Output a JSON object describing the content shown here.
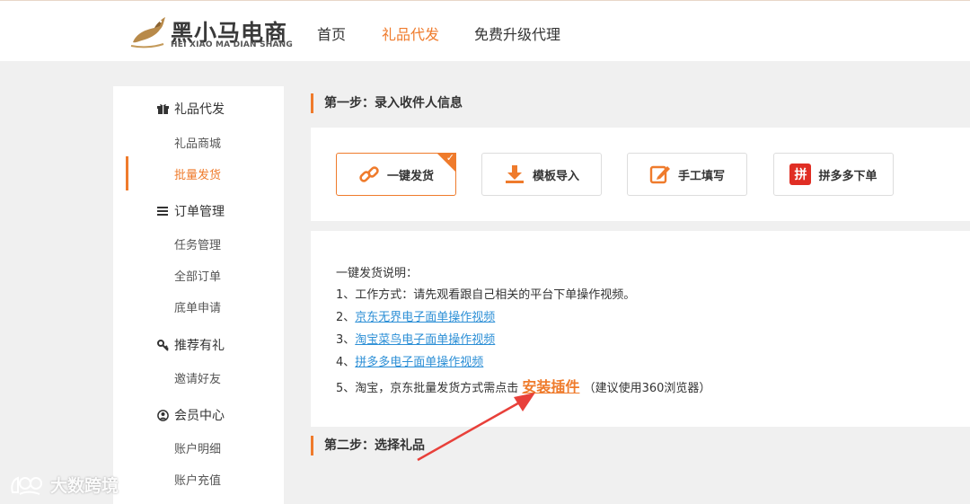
{
  "header": {
    "logo_cn": "黑小马电商",
    "logo_en": "HEI XIAO MA DIAN SHANG",
    "nav": [
      "首页",
      "礼品代发",
      "免费升级代理"
    ],
    "active_nav": "礼品代发"
  },
  "sidebar": {
    "groups": [
      {
        "title": "礼品代发",
        "icon": "gift-icon",
        "items": [
          "礼品商城",
          "批量发货"
        ]
      },
      {
        "title": "订单管理",
        "icon": "list-icon",
        "items": [
          "任务管理",
          "全部订单",
          "底单申请"
        ]
      },
      {
        "title": "推荐有礼",
        "icon": "key-icon",
        "items": [
          "邀请好友"
        ]
      },
      {
        "title": "会员中心",
        "icon": "user-icon",
        "items": [
          "账户明细",
          "账户充值"
        ]
      }
    ],
    "active_item": "批量发货"
  },
  "step1": {
    "title": "第一步：录入收件人信息",
    "buttons": [
      {
        "label": "一键发货",
        "icon": "link-icon",
        "selected": true
      },
      {
        "label": "模板导入",
        "icon": "download-icon",
        "selected": false
      },
      {
        "label": "手工填写",
        "icon": "edit-icon",
        "selected": false
      },
      {
        "label": "拼多多下单",
        "icon": "pinduoduo-icon",
        "selected": false
      }
    ],
    "pdd_icon_char": "拼"
  },
  "instructions": {
    "heading": "一键发货说明：",
    "line1": "1、工作方式：请先观看跟自己相关的平台下单操作视频。",
    "line2_prefix": "2、",
    "line2_link": "京东无界电子面单操作视频",
    "line3_prefix": "3、",
    "line3_link": "淘宝菜鸟电子面单操作视频",
    "line4_prefix": "4、",
    "line4_link": "拼多多电子面单操作视频",
    "line5_prefix": "5、淘宝，京东批量发货方式需点击",
    "line5_link": "安装插件",
    "line5_suffix": "（建议使用360浏览器）"
  },
  "step2": {
    "title": "第二步：选择礼品"
  },
  "watermark": {
    "text": "大数跨境"
  },
  "colors": {
    "accent": "#ef7b2c",
    "link": "#2c8fd6",
    "arrow": "#e8403a",
    "pdd": "#e02e24"
  }
}
